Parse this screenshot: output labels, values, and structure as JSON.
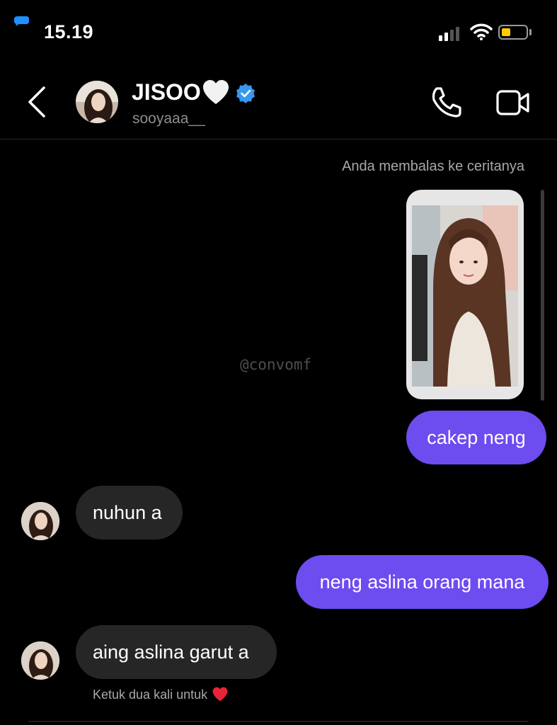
{
  "status": {
    "time": "15.19",
    "battery_color": "#ffcc00"
  },
  "header": {
    "name": "JISOO",
    "name_suffix_icon": "white-heart-icon",
    "verified_icon": "verified-badge-icon",
    "username": "sooyaaa__",
    "icons": [
      "back-chevron-icon",
      "phone-icon",
      "video-camera-icon"
    ]
  },
  "conversation": {
    "reply_note": "Anda membalas ke ceritanya",
    "watermark": "@convomf",
    "messages": [
      {
        "from": "me",
        "text": "cakep neng"
      },
      {
        "from": "them",
        "text": "nuhun a"
      },
      {
        "from": "me",
        "text": "neng aslina orang mana"
      },
      {
        "from": "them",
        "text": "aing aslina garut a"
      }
    ],
    "hint": "Ketuk dua kali untuk",
    "hint_icon": "red-heart-icon"
  },
  "colors": {
    "sent_bubble": "#6d4cf0",
    "received_bubble": "#262626",
    "background": "#000000"
  }
}
